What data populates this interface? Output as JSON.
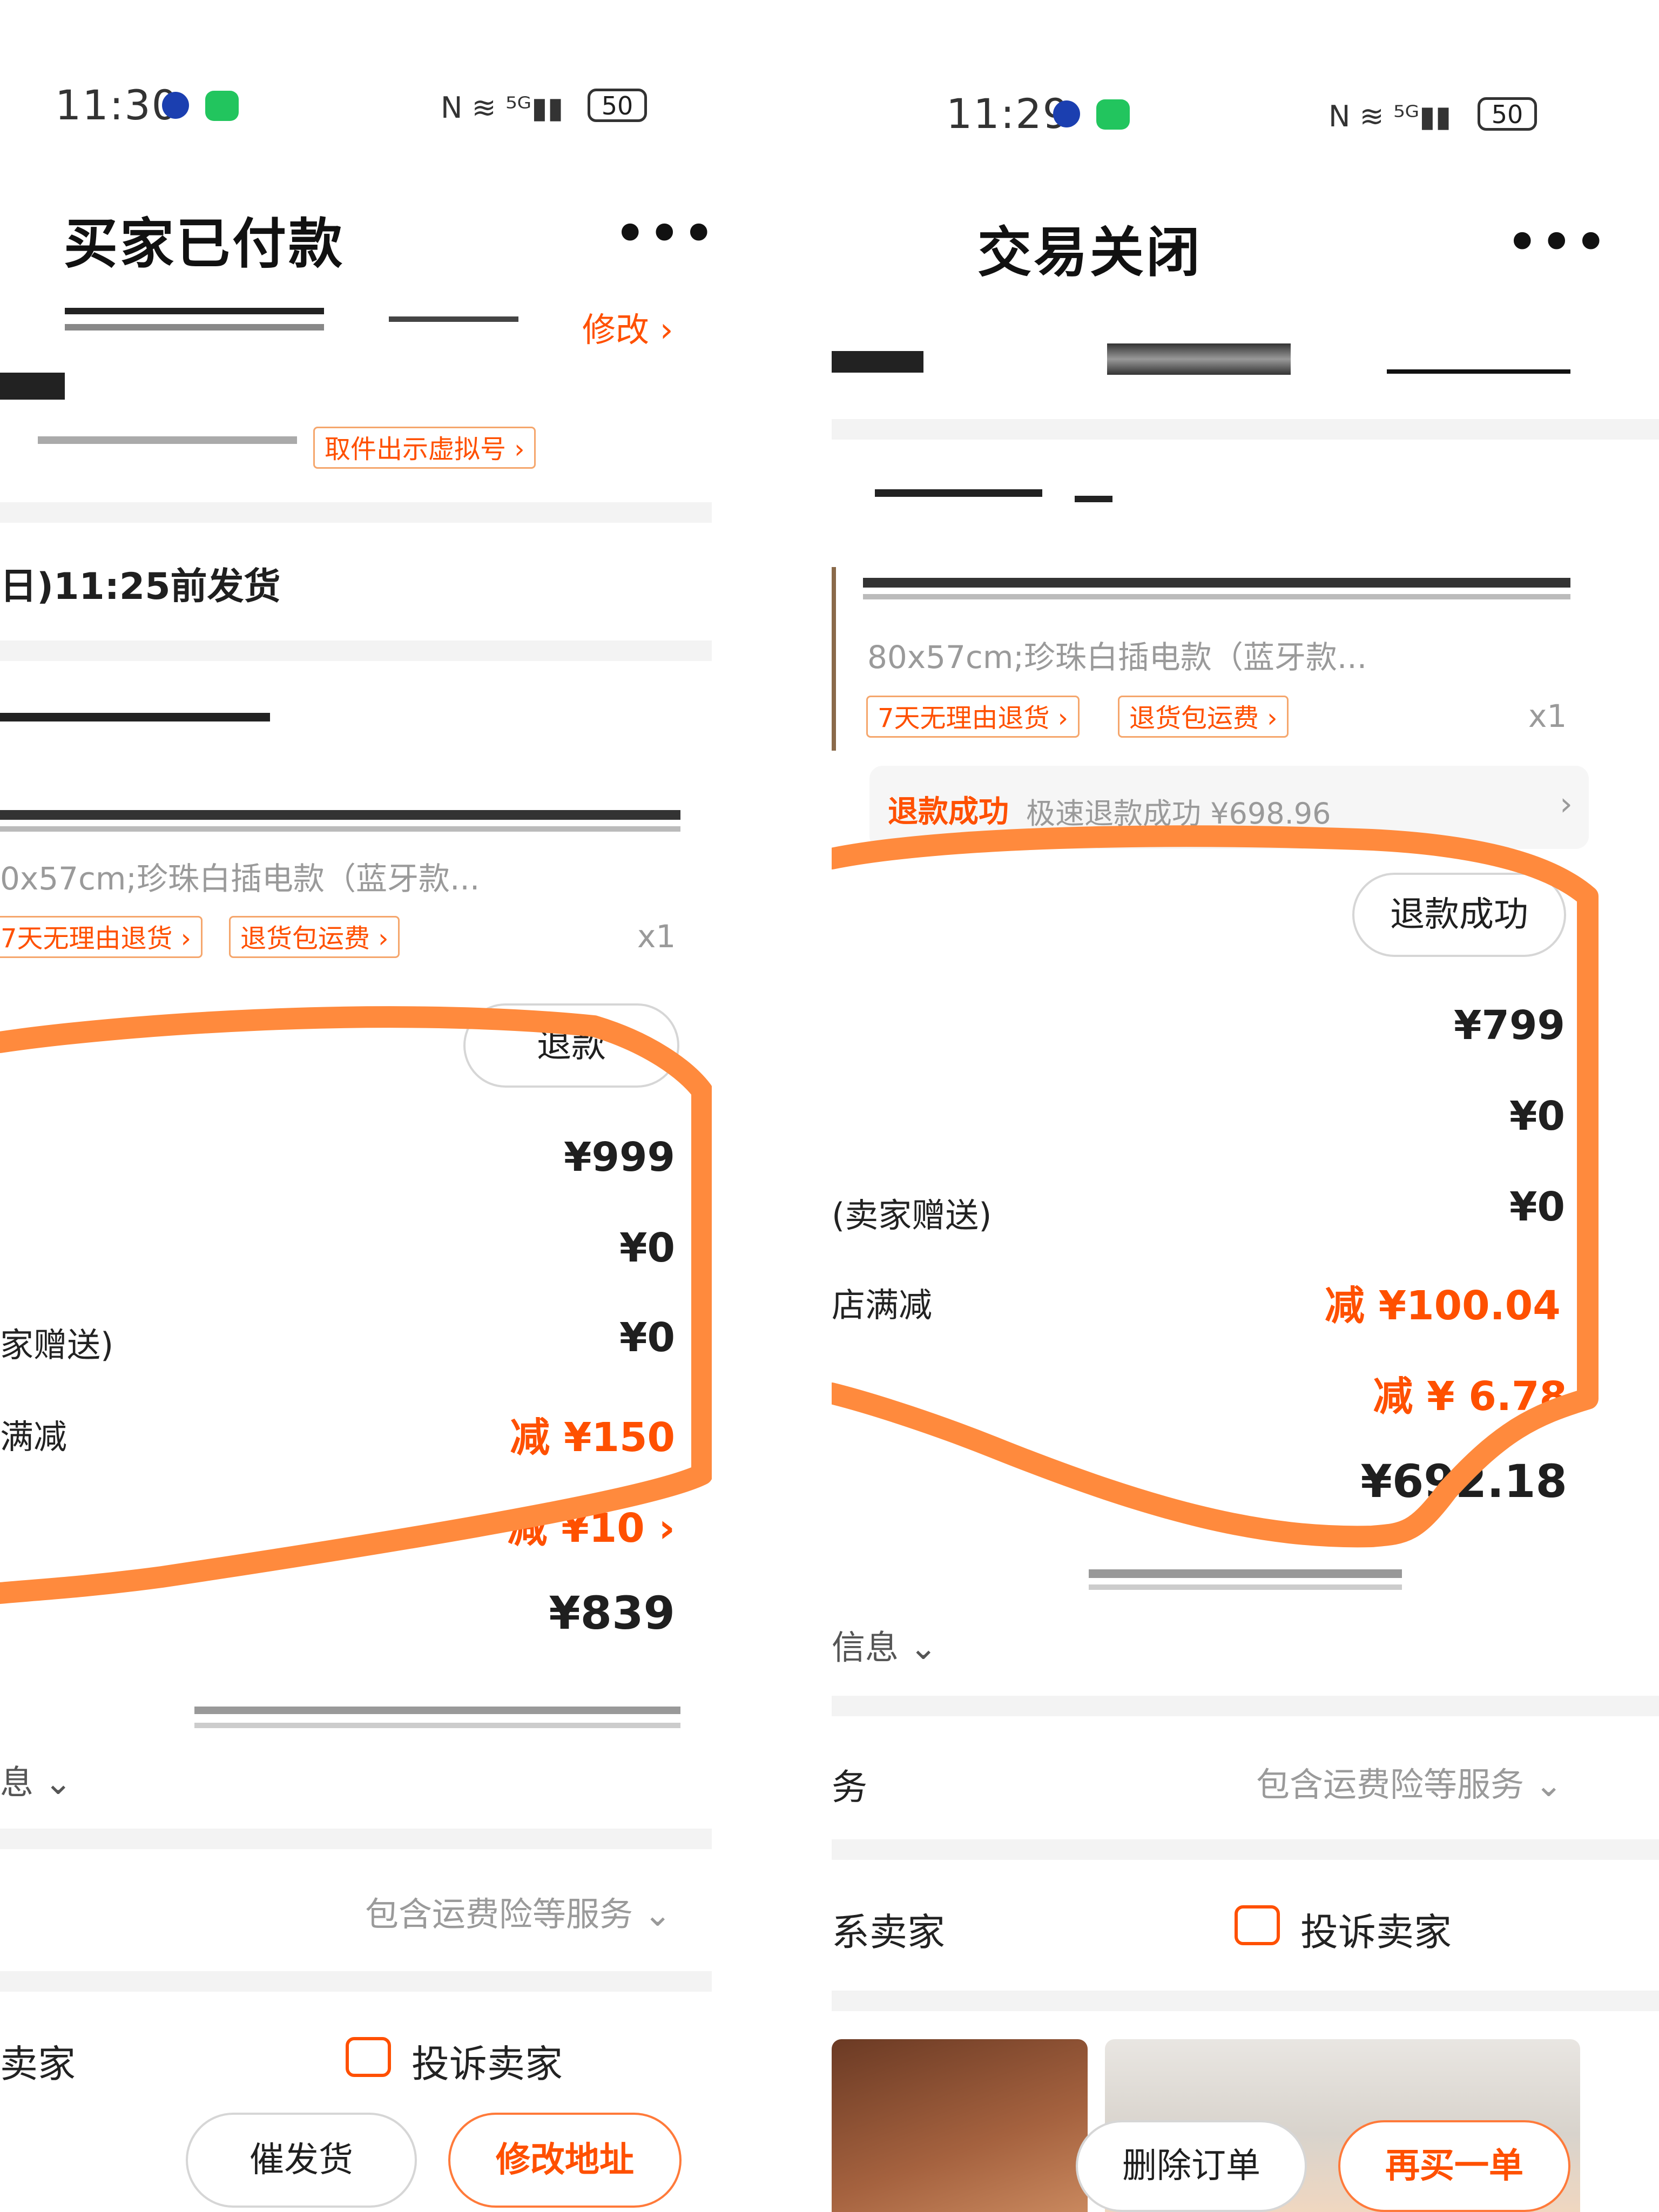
{
  "left": {
    "status_time": "11:30",
    "battery": "50",
    "title": "买家已付款",
    "more": "•••",
    "modify_address": "修改 ›",
    "virtual_number": "取件出示虚拟号 ›",
    "ship_deadline": "日)11:25前发货",
    "spec": "0x57cm;珍珠白插电款（蓝牙款...",
    "tag_return": "7天无理由退货 ›",
    "tag_shipping": "退货包运费 ›",
    "qty": "x1",
    "refund_btn": "退款",
    "price_total": "¥999",
    "price_zero_1": "¥0",
    "seller_gift": "家赠送)",
    "price_zero_2": "¥0",
    "full_reduce_label": "满减",
    "full_reduce_amount": "减 ¥150",
    "discount_amount": "减 ¥10 ›",
    "paid_amount": "¥839",
    "info_label": "息 ⌄",
    "service_label": "包含运费险等服务 ⌄",
    "contact_seller": "卖家",
    "complain_seller": "投诉卖家",
    "btn_urge": "催发货",
    "btn_modify_address": "修改地址"
  },
  "right": {
    "status_time": "11:29",
    "battery": "50",
    "title": "交易关闭",
    "more": "•••",
    "spec": "80x57cm;珍珠白插电款（蓝牙款...",
    "tag_return": "7天无理由退货 ›",
    "tag_shipping": "退货包运费 ›",
    "qty": "x1",
    "refund_status": "退款成功",
    "refund_detail": "极速退款成功 ¥698.96",
    "refund_btn": "退款成功",
    "price_total": "¥799",
    "price_zero_1": "¥0",
    "seller_gift": "(卖家赠送)",
    "price_zero_2": "¥0",
    "full_reduce_label": "店满减",
    "full_reduce_amount": "减 ¥100.04 ›",
    "discount_amount": "减 ¥ 6.78",
    "paid_amount": "¥692.18",
    "info_label": "信息 ⌄",
    "service_prefix": "务",
    "service_label": "包含运费险等服务 ⌄",
    "contact_seller": "系卖家",
    "complain_seller": "投诉卖家",
    "btn_delete": "删除订单",
    "btn_rebuy": "再买一单"
  },
  "colors": {
    "accent": "#ff5000",
    "annotation": "#ff8a3d",
    "divider": "#f3f3f3"
  }
}
